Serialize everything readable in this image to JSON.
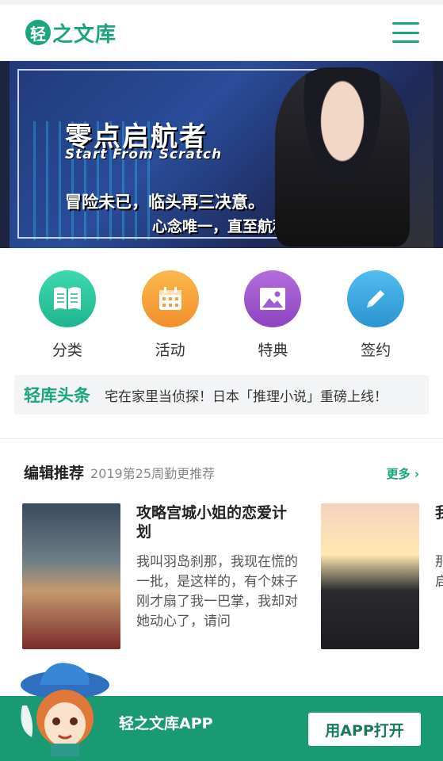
{
  "header": {
    "logo_glyph": "轻",
    "logo_text": "之文库"
  },
  "banner": {
    "title": "零点启航者",
    "subtitle": "Start From Scratch",
    "line1": "冒险未已，临头再三决意。",
    "line2": "心念唯一，直至航程终矣。"
  },
  "quick_nav": [
    {
      "label": "分类",
      "icon": "book-icon",
      "color": "#2cc3a0"
    },
    {
      "label": "活动",
      "icon": "calendar-icon",
      "color": "#f7a43e"
    },
    {
      "label": "特典",
      "icon": "image-icon",
      "color": "#a259d0"
    },
    {
      "label": "签约",
      "icon": "pencil-icon",
      "color": "#3aa8e0"
    }
  ],
  "news": {
    "tag": "轻库头条",
    "text": "宅在家里当侦探！日本「推理小说」重磅上线！"
  },
  "recommend": {
    "title": "编辑推荐",
    "subtitle": "2019第25周勤更推荐",
    "more": "更多"
  },
  "books": [
    {
      "title": "攻略宫城小姐的恋爱计划",
      "desc": "我叫羽岛刹那，我现在慌的一批，是这样的，有个妹子刚才扇了我一巴掌，我却对她动心了，请问"
    },
    {
      "title": "我的",
      "desc": "那隐资启"
    }
  ],
  "app_bar": {
    "label": "轻之文库APP",
    "button": "用APP打开"
  }
}
